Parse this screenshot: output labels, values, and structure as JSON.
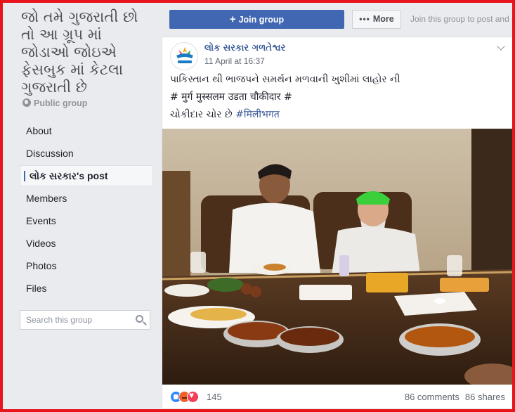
{
  "group": {
    "title": "જો તમે ગુજરાતી છો તો આ ગ્રૂપ માં જોડાઓ જોઇએ ફેસબુક માં કેટલા ગુજરાતી છે",
    "privacy": "Public group"
  },
  "nav": {
    "items": [
      {
        "label": "About"
      },
      {
        "label": "Discussion"
      },
      {
        "label": "લોક સરકાર's post"
      },
      {
        "label": "Members"
      },
      {
        "label": "Events"
      },
      {
        "label": "Videos"
      },
      {
        "label": "Photos"
      },
      {
        "label": "Files"
      }
    ],
    "active_index": 2
  },
  "search": {
    "placeholder": "Search this group",
    "icon": "search-icon"
  },
  "topbar": {
    "join_label": "Join group",
    "more_label": "More",
    "join_hint": "Join this group to post and comment."
  },
  "post": {
    "author": "લોક સરકાર ગળતેશ્વર",
    "time": "11 April at 16:37",
    "line1": "પાકિસ્તાન થી ભાજપને સમર્થન મળવાની ખુશીમાં લાહોર ની",
    "line2": "# मुर्ग मुस्सलम उडता चौकीदार #",
    "line3_text": "ચોકીદાર ચોર છે ",
    "line3_hashtag": "#मिलीभगत",
    "reaction_count": "145",
    "comments": "86 comments",
    "shares": "86 shares"
  },
  "colors": {
    "frame": "#e8141b",
    "brand": "#4267b2",
    "link": "#385898",
    "background": "#e9ebee"
  }
}
